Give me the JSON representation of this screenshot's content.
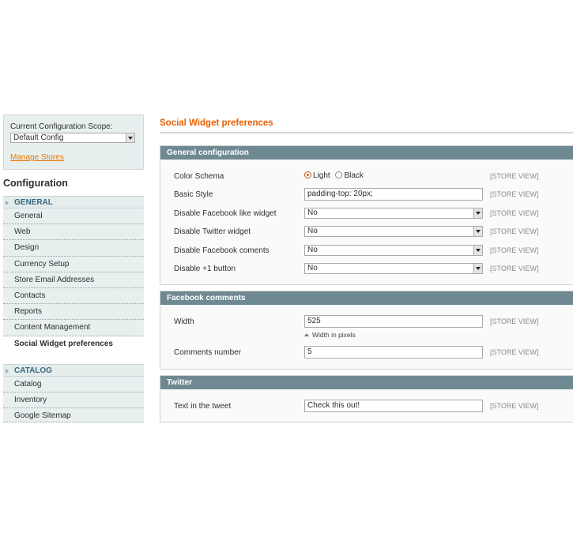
{
  "scope": {
    "label": "Current Configuration Scope:",
    "selected": "Default Config",
    "manage_link": "Manage Stores"
  },
  "sidebar": {
    "title": "Configuration",
    "groups": [
      {
        "name": "GENERAL",
        "items": [
          "General",
          "Web",
          "Design",
          "Currency Setup",
          "Store Email Addresses",
          "Contacts",
          "Reports",
          "Content Management",
          "Social Widget preferences"
        ]
      },
      {
        "name": "CATALOG",
        "items": [
          "Catalog",
          "Inventory",
          "Google Sitemap"
        ]
      }
    ]
  },
  "page": {
    "title": "Social Widget preferences"
  },
  "sections": {
    "general": {
      "title": "General configuration",
      "color_schema_label": "Color Schema",
      "color_schema_options": [
        "Light",
        "Black"
      ],
      "basic_style_label": "Basic Style",
      "basic_style_value": "padding-top: 20px;",
      "fb_like_label": "Disable Facebook like widget",
      "fb_like_value": "No",
      "twitter_widget_label": "Disable Twitter widget",
      "twitter_widget_value": "No",
      "fb_comments_label": "Disable Facebook coments",
      "fb_comments_value": "No",
      "plusone_label": "Disable +1 button",
      "plusone_value": "No"
    },
    "facebook": {
      "title": "Facebook comments",
      "width_label": "Width",
      "width_value": "525",
      "width_note": "Width in pixels",
      "comments_label": "Comments number",
      "comments_value": "5"
    },
    "twitter": {
      "title": "Twitter",
      "tweet_label": "Text in the tweet",
      "tweet_value": "Check this out!"
    }
  },
  "scope_tag": "[STORE VIEW]",
  "colors": {
    "accent": "#eb5e00",
    "section_header": "#6f8992",
    "sidebar_bg": "#e7efef",
    "nav_header_text": "#3a6a80"
  }
}
